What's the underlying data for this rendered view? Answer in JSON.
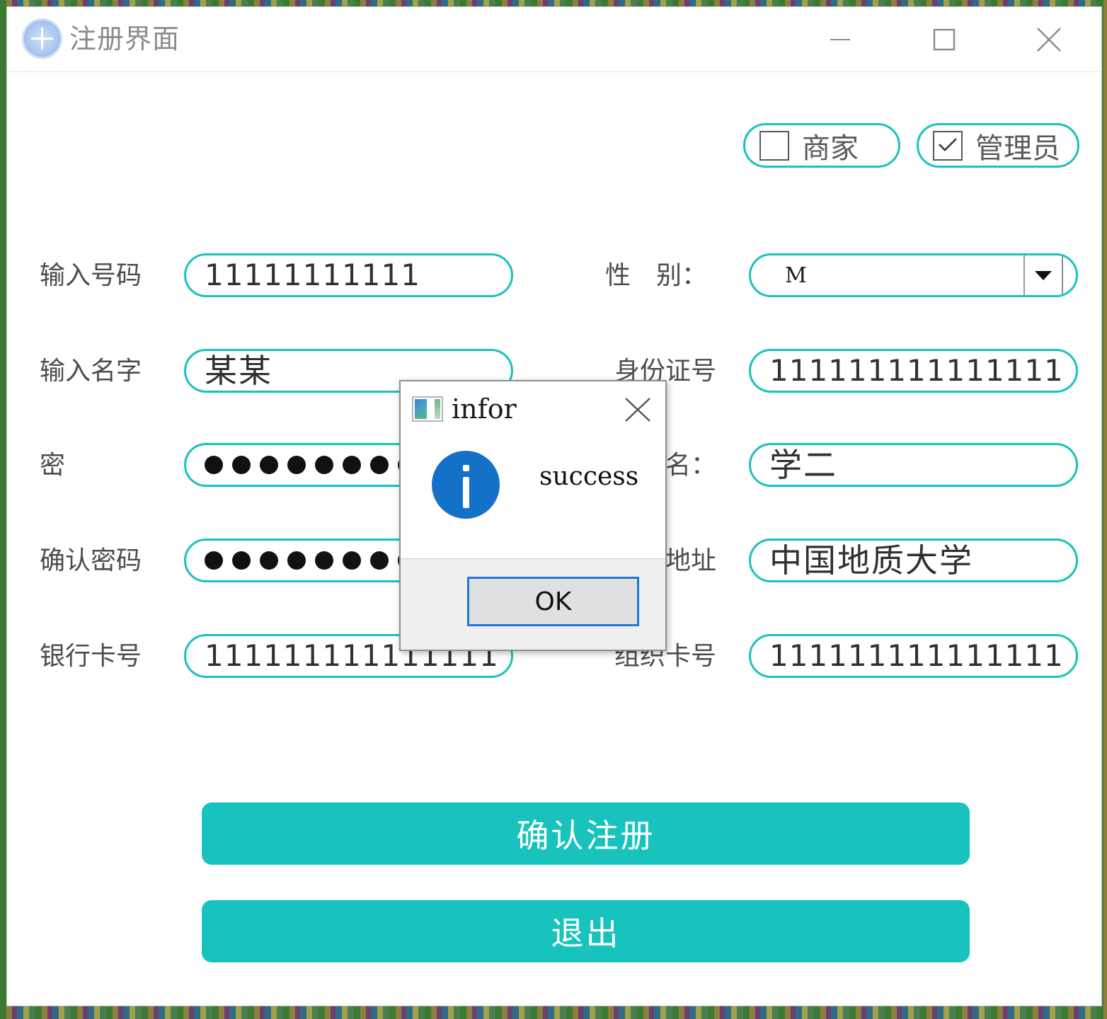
{
  "window": {
    "title": "注册界面",
    "logo_icon": "university-seal-icon",
    "controls": {
      "minimize": "minimize-icon",
      "maximize": "maximize-icon",
      "close": "close-icon"
    }
  },
  "role_options": [
    {
      "label": "商家",
      "checked": false
    },
    {
      "label": "管理员",
      "checked": true
    }
  ],
  "form": {
    "left": [
      {
        "label": "输入号码",
        "value": "11111111111",
        "type": "text"
      },
      {
        "label": "输入名字",
        "value": "某某",
        "type": "cjk"
      },
      {
        "label": "密　　码",
        "value": "●●●●●●●●",
        "type": "password",
        "dots": 8
      },
      {
        "label": "确认密码",
        "value": "●●●●●●●●",
        "type": "password",
        "dots": 8
      },
      {
        "label": "银行卡号",
        "value": "111111111111111",
        "type": "text"
      }
    ],
    "right": [
      {
        "label": "性　别：",
        "value": "M",
        "type": "select"
      },
      {
        "label": "身份证号",
        "value": "111111111111111",
        "type": "text"
      },
      {
        "label": "组织名：",
        "value": "学二",
        "type": "cjk"
      },
      {
        "label": "组织地址",
        "value": "中国地质大学",
        "type": "cjk"
      },
      {
        "label": "组织卡号",
        "value": "111111111111111",
        "type": "text"
      }
    ]
  },
  "actions": {
    "register": "确认注册",
    "exit": "退出"
  },
  "dialog": {
    "title": "infor",
    "icon": "java-window-icon",
    "message": "success",
    "ok_label": "OK",
    "close_icon": "close-icon",
    "info_icon": "info-circle-icon"
  },
  "colors": {
    "accent": "#17c3bc",
    "info_blue": "#1471c8",
    "focus_blue": "#2078d4",
    "title_gray": "#8b8b8b"
  }
}
